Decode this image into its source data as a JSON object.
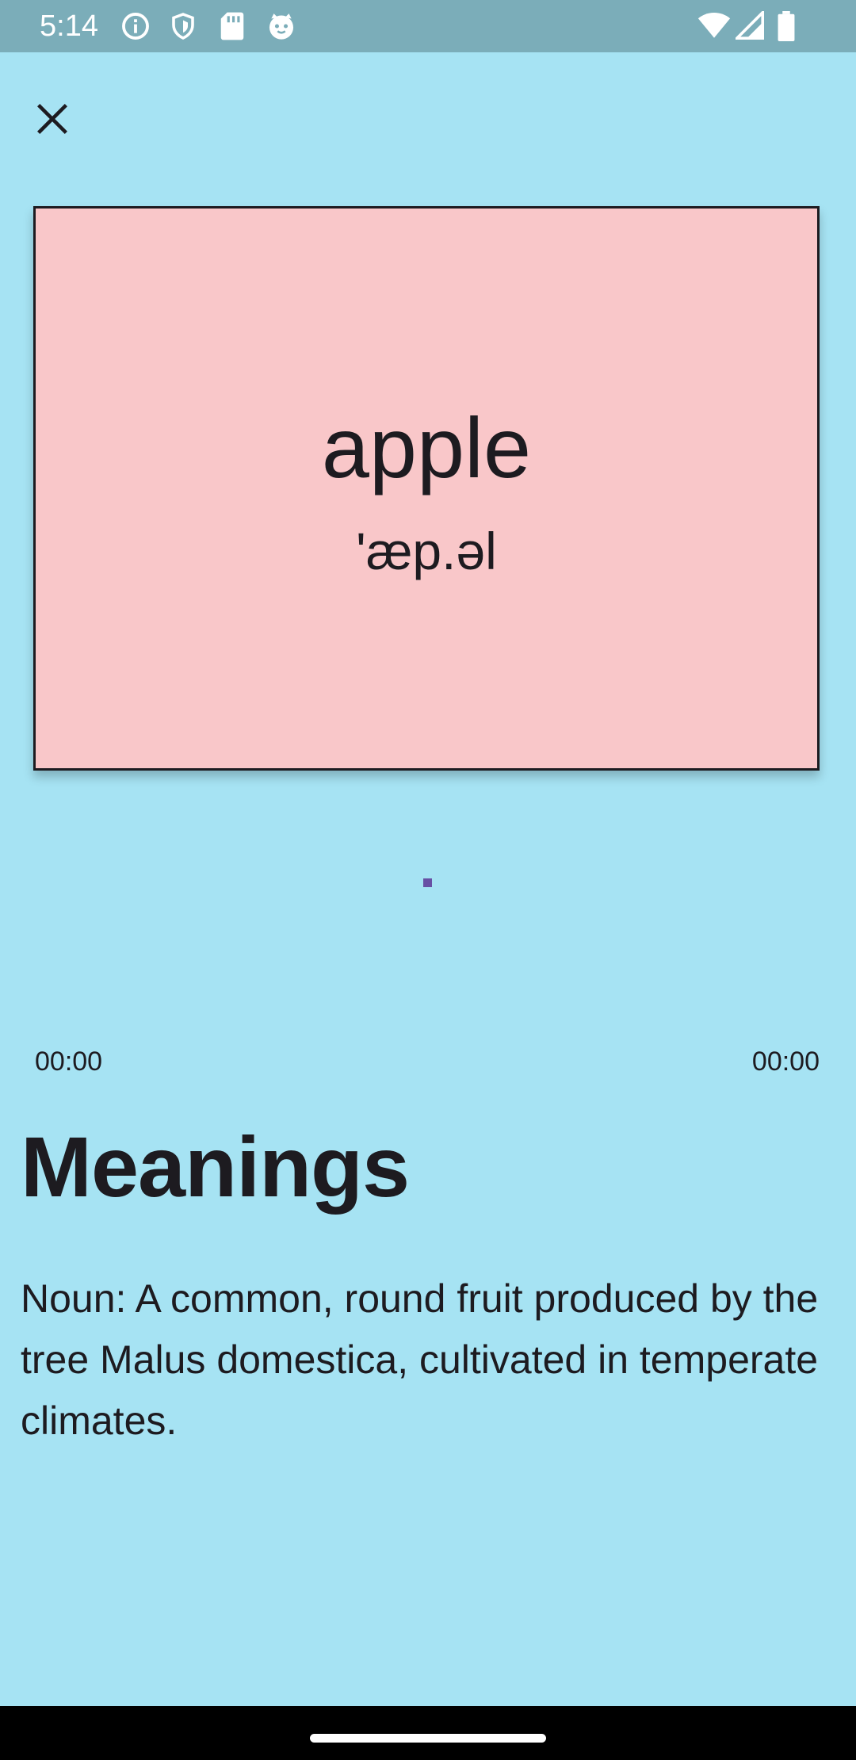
{
  "status_bar": {
    "time": "5:14",
    "left_icons": [
      "info-icon",
      "shield-icon",
      "sd-card-icon",
      "cat-face-icon"
    ],
    "right_icons": [
      "wifi-icon",
      "cellular-signal-icon",
      "battery-icon"
    ]
  },
  "header": {
    "close_icon": "close-icon"
  },
  "card": {
    "word": "apple",
    "phonetic": "'æp.əl",
    "background": "#f9c7c9"
  },
  "audio": {
    "current_time": "00:00",
    "total_time": "00:00",
    "progress": 0,
    "accent": "#6750a4"
  },
  "meanings": {
    "title": "Meanings",
    "text": "Noun: A common, round fruit produced by the tree Malus domestica, cultivated in temperate climates."
  },
  "colors": {
    "page_background": "#a6e3f3",
    "status_bar": "#7badb9"
  }
}
